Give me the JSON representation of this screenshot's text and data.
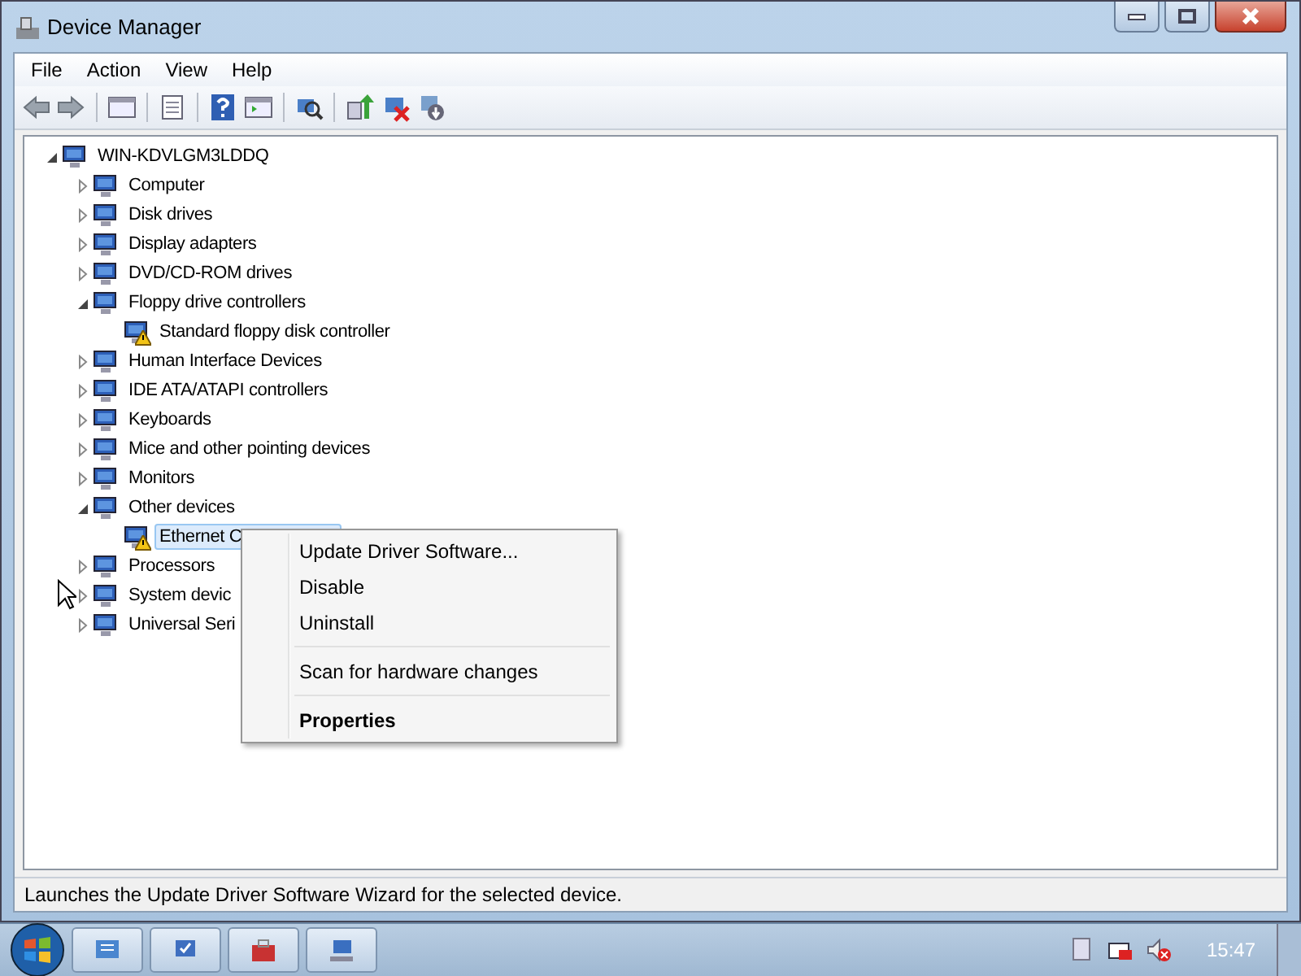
{
  "window": {
    "title": "Device Manager"
  },
  "menu": [
    "File",
    "Action",
    "View",
    "Help"
  ],
  "tree": {
    "label": "WIN-KDVLGM3LDDQ",
    "expanded": true,
    "selected": false,
    "warning": false,
    "children": [
      {
        "label": "Computer",
        "expanded": false,
        "selected": false,
        "warning": false
      },
      {
        "label": "Disk drives",
        "expanded": false,
        "selected": false,
        "warning": false
      },
      {
        "label": "Display adapters",
        "expanded": false,
        "selected": false,
        "warning": false
      },
      {
        "label": "DVD/CD-ROM drives",
        "expanded": false,
        "selected": false,
        "warning": false
      },
      {
        "label": "Floppy drive controllers",
        "expanded": true,
        "selected": false,
        "warning": false,
        "children": [
          {
            "label": "Standard floppy disk controller",
            "selected": false,
            "warning": true
          }
        ]
      },
      {
        "label": "Human Interface Devices",
        "expanded": false,
        "selected": false,
        "warning": false
      },
      {
        "label": "IDE ATA/ATAPI controllers",
        "expanded": false,
        "selected": false,
        "warning": false
      },
      {
        "label": "Keyboards",
        "expanded": false,
        "selected": false,
        "warning": false
      },
      {
        "label": "Mice and other pointing devices",
        "expanded": false,
        "selected": false,
        "warning": false
      },
      {
        "label": "Monitors",
        "expanded": false,
        "selected": false,
        "warning": false
      },
      {
        "label": "Other devices",
        "expanded": true,
        "selected": false,
        "warning": false,
        "children": [
          {
            "label": "Ethernet C",
            "selected": true,
            "warning": true
          }
        ]
      },
      {
        "label": "Processors",
        "expanded": false,
        "selected": false,
        "warning": false
      },
      {
        "label": "System devic",
        "expanded": false,
        "selected": false,
        "warning": false
      },
      {
        "label": "Universal Seri",
        "expanded": false,
        "selected": false,
        "warning": false
      }
    ]
  },
  "context_menu": [
    {
      "kind": "item",
      "label": "Update Driver Software...",
      "default": false
    },
    {
      "kind": "item",
      "label": "Disable",
      "default": false
    },
    {
      "kind": "item",
      "label": "Uninstall",
      "default": false
    },
    {
      "kind": "separator"
    },
    {
      "kind": "item",
      "label": "Scan for hardware changes",
      "default": false
    },
    {
      "kind": "separator"
    },
    {
      "kind": "item",
      "label": "Properties",
      "default": true
    }
  ],
  "status_bar": "Launches the Update Driver Software Wizard for the selected device.",
  "taskbar": {
    "clock": "15:47"
  }
}
